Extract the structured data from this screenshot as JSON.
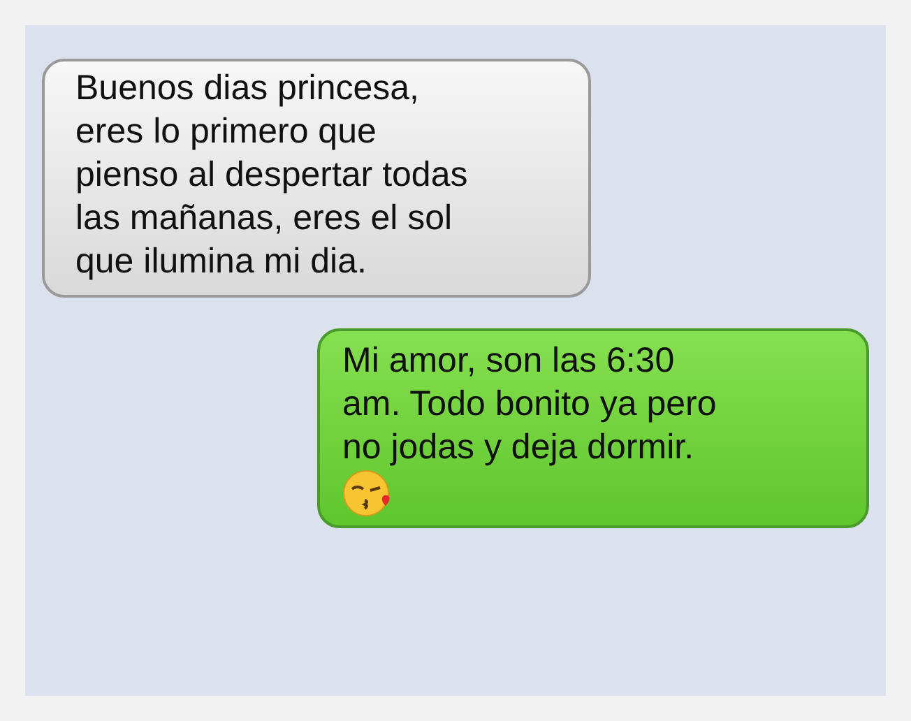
{
  "messages": [
    {
      "kind": "received",
      "text": "Buenos dias princesa,\neres lo primero que\npienso al despertar todas\nlas mañanas, eres el sol\nque ilumina mi dia."
    },
    {
      "kind": "sent",
      "text": "Mi amor, son las 6:30\nam. Todo bonito ya pero\nno jodas y deja dormir.",
      "emoji": true
    }
  ]
}
